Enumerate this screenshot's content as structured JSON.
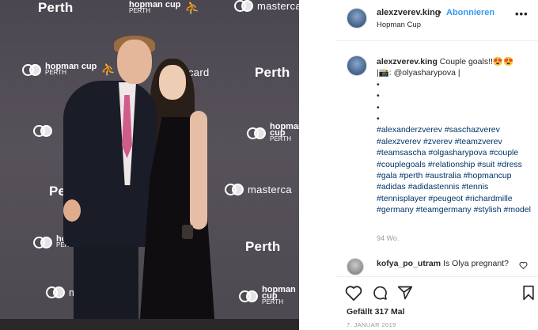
{
  "photo": {
    "backdrop": {
      "city": "Perth",
      "sponsor": "mastercard",
      "sponsor_partial_1": "masterca",
      "sponsor_partial_2": "card",
      "sponsor_partial_3": "maste",
      "event_line1": "hopman cup",
      "event_line2": "PERTH",
      "city_partial": "Pe"
    }
  },
  "post": {
    "username": "alexzverev.king",
    "separator": "•",
    "follow_label": "Abonnieren",
    "location": "Hopman Cup",
    "more_label": "•••",
    "caption_username": "alexzverev.king",
    "caption_text": "Couple goals!!😍😍",
    "caption_credit": "|📸: @olyasharypova |",
    "caption_bullets": [
      "•",
      "•",
      "•",
      "•"
    ],
    "hashtags": [
      "#alexanderzverev",
      "#saschazverev",
      "#alexzverev",
      "#zverev",
      "#teamzverev",
      "#teamsascha",
      "#olgasharypova",
      "#couple",
      "#couplegoals",
      "#relationship",
      "#suit",
      "#dress",
      "#gala",
      "#perth",
      "#australia",
      "#hopmancup",
      "#adidas",
      "#adidastennis",
      "#tennis",
      "#tennisplayer",
      "#peugeot",
      "#richardmille",
      "#germany",
      "#teamgermany",
      "#stylish",
      "#model"
    ],
    "caption_age": "94 Wo.",
    "comment_user": "kofya_po_utram",
    "comment_text": "Is Olya pregnant?",
    "likes_label": "Gefällt 317 Mal",
    "date_label": "7. JANUAR 2019"
  },
  "icons": {
    "like": "heart-icon",
    "comment": "comment-icon",
    "share": "send-icon",
    "save": "bookmark-icon"
  },
  "colors": {
    "follow_blue": "#3897f0",
    "hashtag": "#003569",
    "muted": "#999999"
  }
}
